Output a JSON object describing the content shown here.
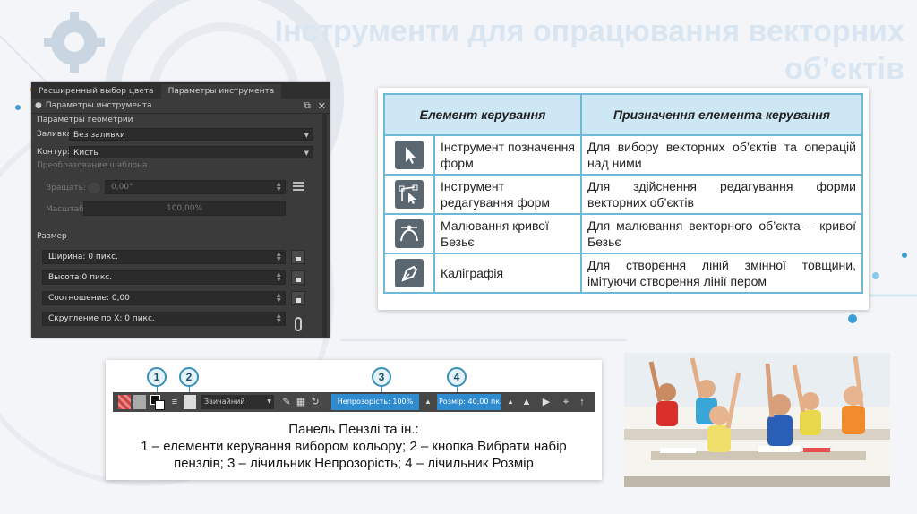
{
  "slide": {
    "title": "Інструменти для опрацювання векторних об’єктів"
  },
  "docker": {
    "tabs": [
      "Расширенный выбор цвета",
      "Параметры инструмента"
    ],
    "active_tab": 1,
    "header_title": "Параметры инструмента",
    "geometry_section": "Параметры геометрии",
    "fill_label": "Заливка:",
    "fill_value": "Без заливки",
    "stroke_label": "Контур:",
    "stroke_value": "Кисть",
    "transform_section": "Преобразование шаблона",
    "rotate_label": "Вращать:",
    "rotate_value": "0,00°",
    "scale_label": "Масштаб:",
    "scale_value": "100,00%",
    "size_section": "Размер",
    "width_field": "Ширина: 0 пикс.",
    "height_field": "Высота:0 пикс.",
    "ratio_field": "Соотношение: 0,00",
    "rounding_field": "Скругление по X: 0 пикс."
  },
  "table": {
    "headers": [
      "Елемент керування",
      "Призначення елемента керування"
    ],
    "rows": [
      {
        "icon": "select-arrow-icon",
        "name": "Інструмент позначення форм",
        "purpose": "Для вибору векторних об’єктів та операцій над ними"
      },
      {
        "icon": "edit-shape-icon",
        "name": "Інструмент редагування форм",
        "purpose": "Для здійснення редагування форми векторних об’єктів"
      },
      {
        "icon": "bezier-curve-icon",
        "name": "Малювання кривої Безьє",
        "purpose": "Для малювання векторного об’єкта – кривої Безьє"
      },
      {
        "icon": "calligraphy-pen-icon",
        "name": "Каліграфія",
        "purpose": "Для створення ліній змінної товщини, імітуючи створення лінії пером"
      }
    ]
  },
  "toolbar_panel": {
    "markers": [
      "1",
      "2",
      "3",
      "4"
    ],
    "blend_mode": "Звичайний",
    "opacity_slider": "Непрозорість: 100%",
    "size_slider": "Розмір: 40,00 пк",
    "caption_line1": "Панель Пензлі та ін.:",
    "caption_line2": "1 – елементи керування вибором кольору; 2 – кнопка Вибрати набір пензлів; 3 – лічильник Непрозорість; 4 – лічильник Розмір"
  }
}
